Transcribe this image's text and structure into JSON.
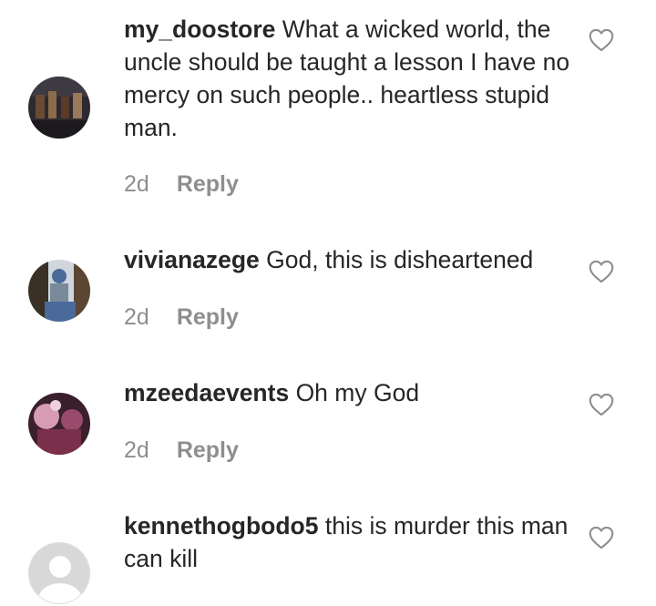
{
  "comments": [
    {
      "username": "my_doostore",
      "text": "What a wicked world, the uncle should be taught a lesson I have no mercy on such people.. heartless stupid man.",
      "time": "2d",
      "reply_label": "Reply",
      "avatar_colors": [
        "#6b4a34",
        "#2c2a30"
      ]
    },
    {
      "username": "vivianazege",
      "text": "God, this is disheartened",
      "time": "2d",
      "reply_label": "Reply",
      "avatar_colors": [
        "#4a6a9a",
        "#cfd6de"
      ]
    },
    {
      "username": "mzeedaevents",
      "text": "Oh my God",
      "time": "2d",
      "reply_label": "Reply",
      "avatar_colors": [
        "#7a2f4a",
        "#d79bb4"
      ]
    },
    {
      "username": "kennethogbodo5",
      "text": "this is murder this man can kill",
      "time": "",
      "reply_label": "",
      "avatar_colors": [
        "#d8d8d8",
        "#ffffff"
      ]
    }
  ],
  "icons": {
    "like": "heart-outline-icon",
    "default_avatar": "person-silhouette-icon"
  },
  "colors": {
    "text": "#262626",
    "muted": "#8e8e8e",
    "heart": "#8e8e8e"
  }
}
